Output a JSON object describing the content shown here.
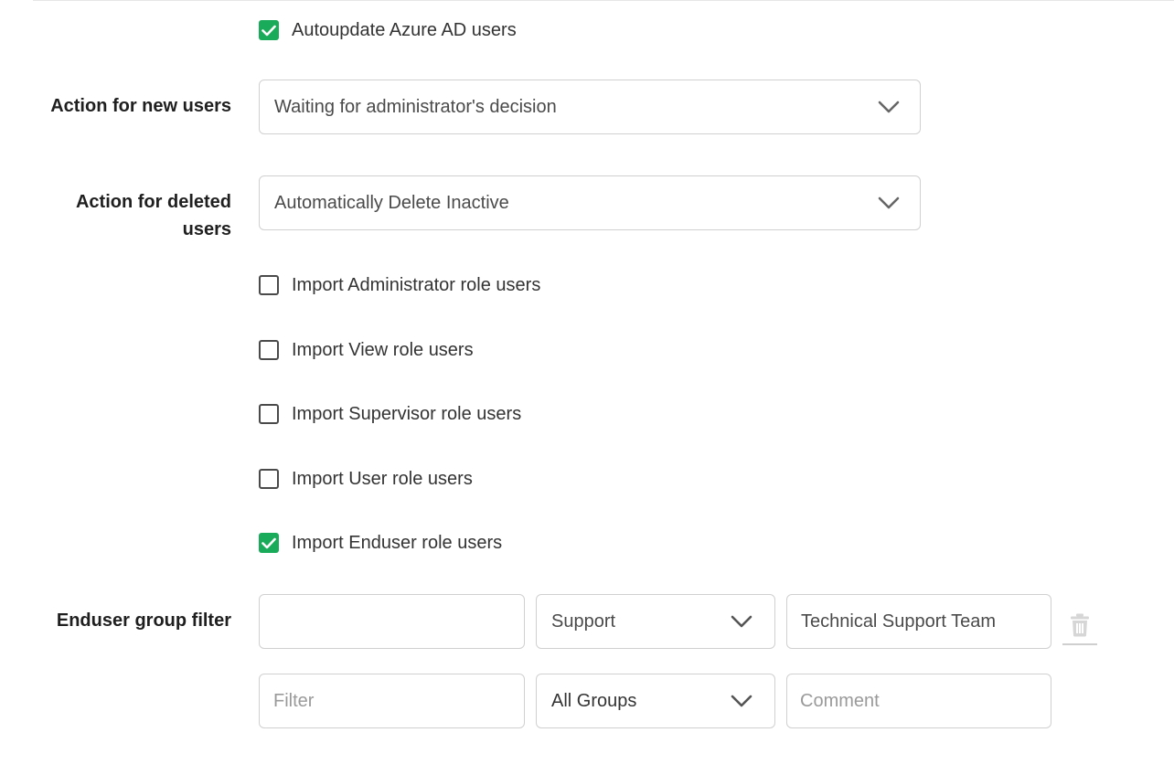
{
  "theme": {
    "accent": "#1aab5a"
  },
  "autoupdate": {
    "label": "Autoupdate Azure AD users",
    "checked": true
  },
  "new_users": {
    "label": "Action for new users",
    "value": "Waiting for administrator's decision"
  },
  "deleted_users": {
    "label_line1": "Action for deleted",
    "label_line2": "users",
    "value": "Automatically Delete Inactive"
  },
  "roles": [
    {
      "label": "Import Administrator role users",
      "checked": false
    },
    {
      "label": "Import View role users",
      "checked": false
    },
    {
      "label": "Import Supervisor role users",
      "checked": false
    },
    {
      "label": "Import User role users",
      "checked": false
    },
    {
      "label": "Import Enduser role users",
      "checked": true
    }
  ],
  "group_filter": {
    "label": "Enduser group filter",
    "rows": [
      {
        "filter_value": "",
        "group": "Support",
        "comment_value": "Technical Support Team",
        "icon": "trash-icon"
      },
      {
        "filter_placeholder": "Filter",
        "group": "All Groups",
        "comment_placeholder": "Comment"
      }
    ]
  }
}
